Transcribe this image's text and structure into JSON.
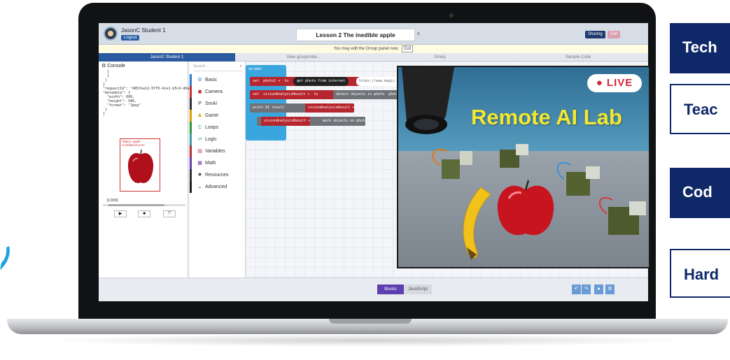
{
  "app": {
    "student_name": "JasonC Student 1",
    "logout": "Logout",
    "lesson_title": "Lesson 2 The inedible apple",
    "title_close": "x",
    "top_buttons": [
      "Sharing",
      "Exit"
    ],
    "notice": "You may edit the Group panel now.",
    "notice_exit": "Exit"
  },
  "tabs": [
    {
      "label": "JasonC Student 1",
      "active": true
    },
    {
      "label": "View groupmate...",
      "active": false
    },
    {
      "label": "Group",
      "active": false
    },
    {
      "label": "Sample Code",
      "active": false
    }
  ],
  "console": {
    "title": "Console",
    "output": "  }\n  }\n }\n}\n\"requestId\": \"4857ee12-57f0-4ce1-b5c4-d6ab\n\"metadata\": {\n  \"width\": 600,\n  \"height\": 586,\n  \"format\": \"Jpeg\"\n }\n}",
    "detection_label": "Object: apple\nConfidence:0.87",
    "coords": "[L000]",
    "controls": [
      "▶",
      "■",
      "⤧"
    ]
  },
  "categories": {
    "search_placeholder": "Search...",
    "items": [
      {
        "label": "Basic",
        "icon": "⚙",
        "color": "#2f7fd1"
      },
      {
        "label": "Camera",
        "icon": "◼",
        "color": "#c9312e"
      },
      {
        "label": "SmAI",
        "icon": "P",
        "color": "#333333"
      },
      {
        "label": "Game",
        "icon": "♟",
        "color": "#e0a100"
      },
      {
        "label": "Loops",
        "icon": "C",
        "color": "#2a9a3c"
      },
      {
        "label": "Logic",
        "icon": "⇄",
        "color": "#39a0a8"
      },
      {
        "label": "Variables",
        "icon": "▤",
        "color": "#b5323a"
      },
      {
        "label": "Math",
        "icon": "▦",
        "color": "#6a3fb0"
      },
      {
        "label": "Resources",
        "icon": "❖",
        "color": "#333333"
      },
      {
        "label": "Advanced",
        "icon": "⌄",
        "color": "#222222"
      }
    ]
  },
  "blocks": {
    "on_start": "on start",
    "set": "set",
    "var_photo": "photo1 ▾",
    "to": "to",
    "get_photo": "get photo from internet",
    "url": "https://www.magic.hk/...",
    "var_result": "visionAnalysisResult ▾",
    "detect": "detect objects in photo",
    "photo": "photo1",
    "print": "print AI result",
    "mark": "mark objects on photo"
  },
  "bottom": {
    "blocks_mode": "Blocks",
    "js_mode": "JavaScript",
    "tools": [
      "↶",
      "↷",
      "●",
      "⚙"
    ]
  },
  "live": {
    "badge": "● LIVE",
    "title": "Remote AI Lab"
  },
  "side_menu": [
    "Tech",
    "Teac",
    "Cod",
    "Hard"
  ],
  "colors": {
    "brand_navy": "#0f2868",
    "active_tab": "#2c5aa0",
    "blocks_mode": "#5d3fb0",
    "live_red": "#d3263a",
    "live_title_yellow": "#f3e82e"
  }
}
